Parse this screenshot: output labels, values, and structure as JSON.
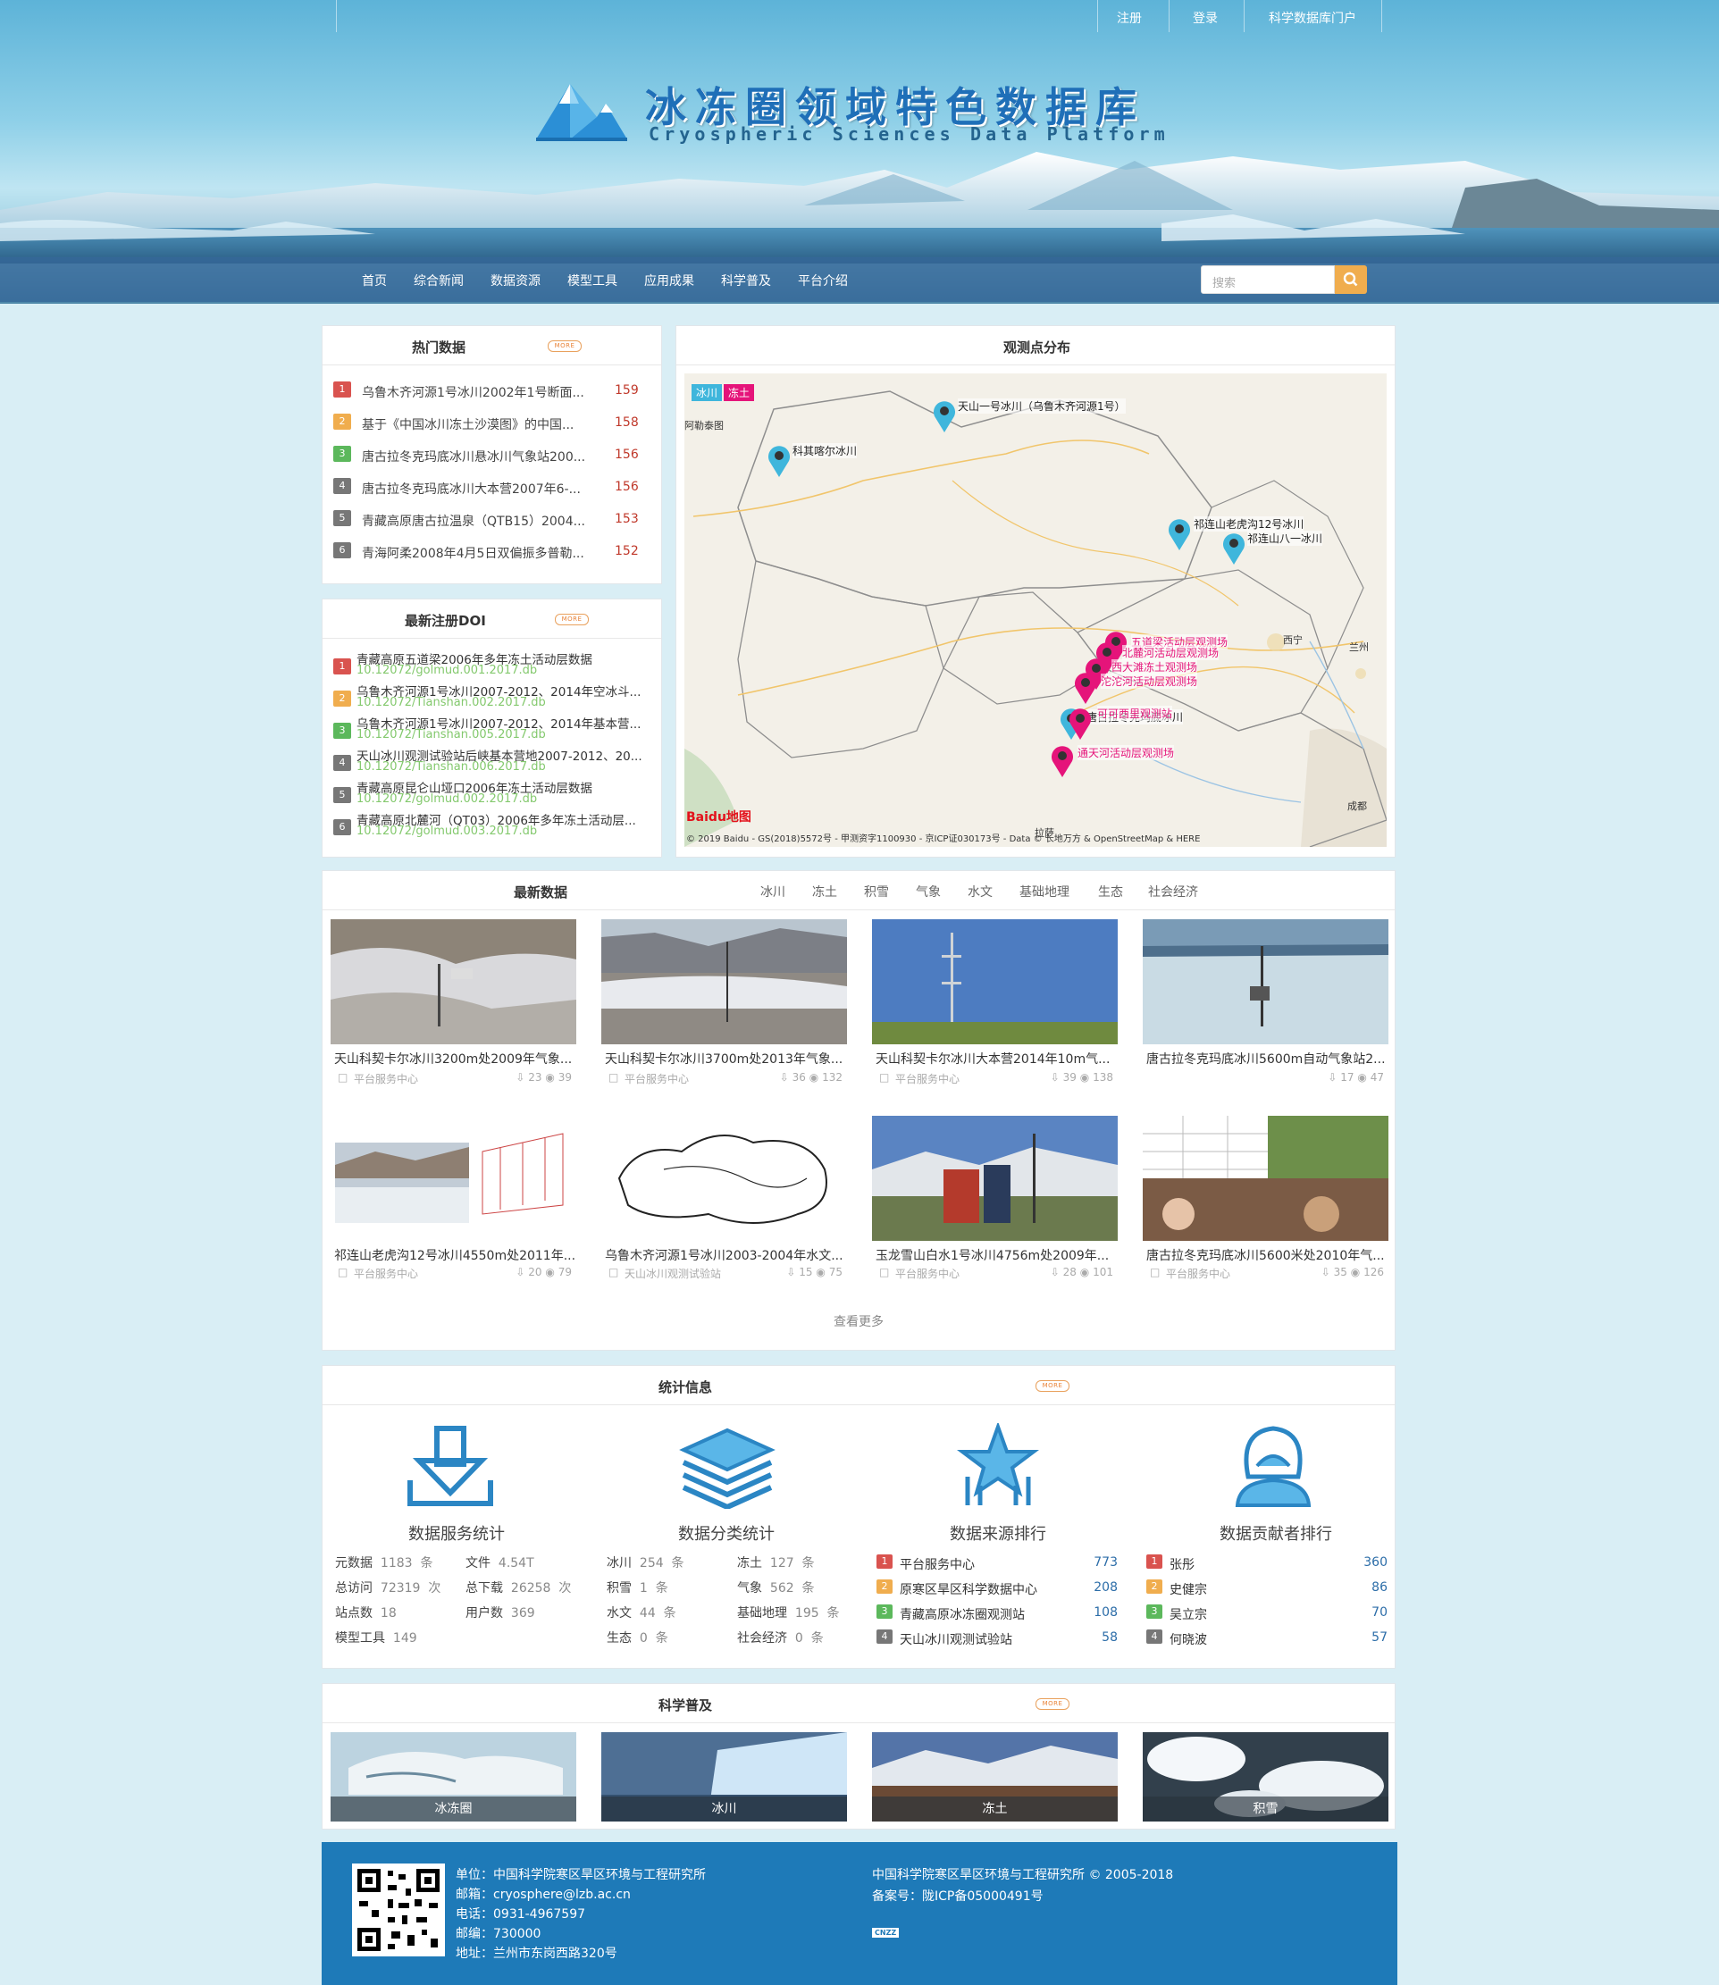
{
  "topnav": {
    "register": "注册",
    "login": "登录",
    "portal": "科学数据库门户"
  },
  "brand": {
    "title_cn": "冰冻圈领域特色数据库",
    "title_en": "Cryospheric Sciences Data Platform"
  },
  "menu": [
    "首页",
    "综合新闻",
    "数据资源",
    "模型工具",
    "应用成果",
    "科学普及",
    "平台介绍"
  ],
  "search": {
    "placeholder": "搜索"
  },
  "more_label": "MORE",
  "hot": {
    "title": "热门数据",
    "items": [
      {
        "rank": "1",
        "title": "乌鲁木齐河源1号冰川2002年1号断面...",
        "count": "159"
      },
      {
        "rank": "2",
        "title": "基于《中国冰川冻土沙漠图》的中国...",
        "count": "158"
      },
      {
        "rank": "3",
        "title": "唐古拉冬克玛底冰川悬冰川气象站200...",
        "count": "156"
      },
      {
        "rank": "4",
        "title": "唐古拉冬克玛底冰川大本营2007年6-...",
        "count": "156"
      },
      {
        "rank": "5",
        "title": "青藏高原唐古拉温泉（QTB15）2004...",
        "count": "153"
      },
      {
        "rank": "6",
        "title": "青海阿柔2008年4月5日双偏振多普勒...",
        "count": "152"
      }
    ]
  },
  "doi": {
    "title": "最新注册DOI",
    "items": [
      {
        "rank": "1",
        "title": "青藏高原五道梁2006年多年冻土活动层数据",
        "doi": "10.12072/golmud.001.2017.db"
      },
      {
        "rank": "2",
        "title": "乌鲁木齐河源1号冰川2007-2012、2014年空冰斗...",
        "doi": "10.12072/Tianshan.002.2017.db"
      },
      {
        "rank": "3",
        "title": "乌鲁木齐河源1号冰川2007-2012、2014年基本营...",
        "doi": "10.12072/Tianshan.005.2017.db"
      },
      {
        "rank": "4",
        "title": "天山冰川观测试验站后峡基本营地2007-2012、20...",
        "doi": "10.12072/Tianshan.006.2017.db"
      },
      {
        "rank": "5",
        "title": "青藏高原昆仑山垭口2006年冻土活动层数据",
        "doi": "10.12072/golmud.002.2017.db"
      },
      {
        "rank": "6",
        "title": "青藏高原北麓河（QT03）2006年多年冻土活动层...",
        "doi": "10.12072/golmud.003.2017.db"
      }
    ]
  },
  "map": {
    "title": "观测点分布",
    "legend": [
      "冰川",
      "冻土"
    ],
    "places": {
      "altay": "阿勒泰图",
      "xining": "西宁",
      "lanzhou": "兰州",
      "chengdu": "成都",
      "lhasa": "拉萨"
    },
    "labels": {
      "tianshan": "天山一号冰川（乌鲁木齐河源1号）",
      "keqi": "科其喀尔冰川",
      "qilian12": "祁连山老虎沟12号冰川",
      "qilian81": "祁连山八一冰川",
      "wudaoliang": "五道梁活动层观测场",
      "beiluhe": "北麓河活动层观测场",
      "xidatan": "西大滩冻土观测场",
      "kekexili": "可可西里观测站",
      "tanggula": "唐古拉冬克玛底冰川",
      "tongtian": "通天河活动层观测场",
      "tuotuohe": "沱沱河活动层观测场"
    },
    "copyright": "© 2019 Baidu - GS(2018)5572号 - 甲测资字1100930 - 京ICP证030173号 - Data © 长地万方 & OpenStreetMap & HERE",
    "baidu_logo": "Baidu地图"
  },
  "latest": {
    "title": "最新数据",
    "tabs": [
      "冰川",
      "冻土",
      "积雪",
      "气象",
      "水文",
      "基础地理",
      "生态",
      "社会经济"
    ],
    "cards": [
      {
        "title": "天山科契卡尔冰川3200m处2009年气象...",
        "source": "平台服务中心",
        "downloads": "23",
        "views": "39"
      },
      {
        "title": "天山科契卡尔冰川3700m处2013年气象...",
        "source": "平台服务中心",
        "downloads": "36",
        "views": "132"
      },
      {
        "title": "天山科契卡尔冰川大本营2014年10m气...",
        "source": "平台服务中心",
        "downloads": "39",
        "views": "138"
      },
      {
        "title": "唐古拉冬克玛底冰川5600m自动气象站2...",
        "source": "",
        "downloads": "17",
        "views": "47"
      },
      {
        "title": "祁连山老虎沟12号冰川4550m处2011年...",
        "source": "平台服务中心",
        "downloads": "20",
        "views": "79"
      },
      {
        "title": "乌鲁木齐河源1号冰川2003-2004年水文...",
        "source": "天山冰川观测试验站",
        "downloads": "15",
        "views": "75"
      },
      {
        "title": "玉龙雪山白水1号冰川4756m处2009年...",
        "source": "平台服务中心",
        "downloads": "28",
        "views": "101"
      },
      {
        "title": "唐古拉冬克玛底冰川5600米处2010年气...",
        "source": "平台服务中心",
        "downloads": "35",
        "views": "126"
      }
    ],
    "see_more": "查看更多"
  },
  "stats": {
    "title": "统计信息",
    "service": {
      "title": "数据服务统计",
      "rows": [
        {
          "label": "元数据",
          "value": "1183",
          "unit": "条"
        },
        {
          "label": "文件",
          "value": "4.54T",
          "unit": ""
        },
        {
          "label": "总访问",
          "value": "72319",
          "unit": "次"
        },
        {
          "label": "总下载",
          "value": "26258",
          "unit": "次"
        },
        {
          "label": "站点数",
          "value": "18",
          "unit": ""
        },
        {
          "label": "用户数",
          "value": "369",
          "unit": ""
        },
        {
          "label": "模型工具",
          "value": "149",
          "unit": ""
        }
      ]
    },
    "category": {
      "title": "数据分类统计",
      "rows": [
        {
          "label": "冰川",
          "value": "254",
          "unit": "条"
        },
        {
          "label": "冻土",
          "value": "127",
          "unit": "条"
        },
        {
          "label": "积雪",
          "value": "1",
          "unit": "条"
        },
        {
          "label": "气象",
          "value": "562",
          "unit": "条"
        },
        {
          "label": "水文",
          "value": "44",
          "unit": "条"
        },
        {
          "label": "基础地理",
          "value": "195",
          "unit": "条"
        },
        {
          "label": "生态",
          "value": "0",
          "unit": "条"
        },
        {
          "label": "社会经济",
          "value": "0",
          "unit": "条"
        }
      ]
    },
    "source": {
      "title": "数据来源排行",
      "rows": [
        {
          "rank": "1",
          "name": "平台服务中心",
          "value": "773"
        },
        {
          "rank": "2",
          "name": "原寒区旱区科学数据中心",
          "value": "208"
        },
        {
          "rank": "3",
          "name": "青藏高原冰冻圈观测站",
          "value": "108"
        },
        {
          "rank": "4",
          "name": "天山冰川观测试验站",
          "value": "58"
        }
      ]
    },
    "contributor": {
      "title": "数据贡献者排行",
      "rows": [
        {
          "rank": "1",
          "name": "张彤",
          "value": "360"
        },
        {
          "rank": "2",
          "name": "史健宗",
          "value": "86"
        },
        {
          "rank": "3",
          "name": "吴立宗",
          "value": "70"
        },
        {
          "rank": "4",
          "name": "何晓波",
          "value": "57"
        }
      ]
    }
  },
  "science": {
    "title": "科学普及",
    "items": [
      "冰冻圈",
      "冰川",
      "冻土",
      "积雪"
    ]
  },
  "footer": {
    "unit": "单位：中国科学院寒区旱区环境与工程研究所",
    "email": "邮箱：cryosphere@lzb.ac.cn",
    "phone": "电话：0931-4967597",
    "postcode": "邮编：730000",
    "address": "地址：兰州市东岗西路320号",
    "copyright": "中国科学院寒区旱区环境与工程研究所 © 2005-2018",
    "icp": "备案号：陇ICP备05000491号",
    "cnzz": "CNZZ"
  },
  "colors": {
    "accent": "#2c6da8",
    "search_button": "#f0ad4e",
    "footer": "#1e7ab8",
    "glacier_tag": "#3fb6dc",
    "frozen_tag": "#e5147a"
  }
}
